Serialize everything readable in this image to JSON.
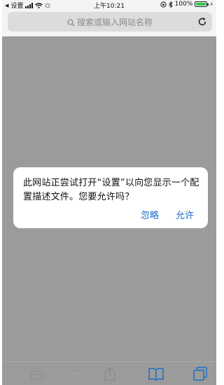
{
  "status_bar": {
    "back_app": "设置",
    "time": "上午10:21",
    "battery_percent": "100%",
    "battery_level": 1.0
  },
  "navbar": {
    "url_placeholder": "搜索或输入网站名称"
  },
  "dialog": {
    "message": "此网站正尝试打开“设置”以向您显示一个配置描述文件。您要允许吗？",
    "ignore_label": "忽略",
    "allow_label": "允许"
  },
  "toolbar": {
    "items": [
      "back-icon",
      "forward-icon",
      "share-icon",
      "bookmarks-icon",
      "tabs-icon"
    ]
  },
  "colors": {
    "accent": "#1b6ec6",
    "overlay": "#9b9b9b",
    "battery": "#2ec850"
  }
}
